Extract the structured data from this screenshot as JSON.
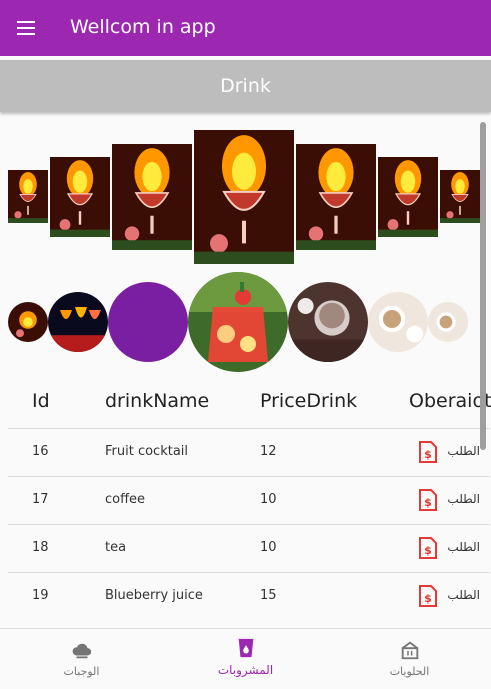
{
  "app": {
    "title": "Wellcom in app"
  },
  "section": {
    "title": "Drink"
  },
  "table": {
    "headers": [
      "Id",
      "drinkName",
      "PriceDrink",
      "Oberaiotn"
    ],
    "rows": [
      {
        "id": "16",
        "name": "Fruit cocktail",
        "price": "12",
        "action": "الطلب"
      },
      {
        "id": "17",
        "name": "coffee",
        "price": "10",
        "action": "الطلب"
      },
      {
        "id": "18",
        "name": "tea",
        "price": "10",
        "action": "الطلب"
      },
      {
        "id": "19",
        "name": "Blueberry juice",
        "price": "15",
        "action": "الطلب"
      }
    ]
  },
  "nav": {
    "items": [
      {
        "label": "الوجبات",
        "icon": "cloud-icon"
      },
      {
        "label": "المشروبات",
        "icon": "cup-icon"
      },
      {
        "label": "الحلويات",
        "icon": "cake-icon"
      }
    ]
  },
  "colors": {
    "primary": "#9c27b0",
    "header_bg": "#bdbdbd",
    "icon_red": "#e53935"
  }
}
